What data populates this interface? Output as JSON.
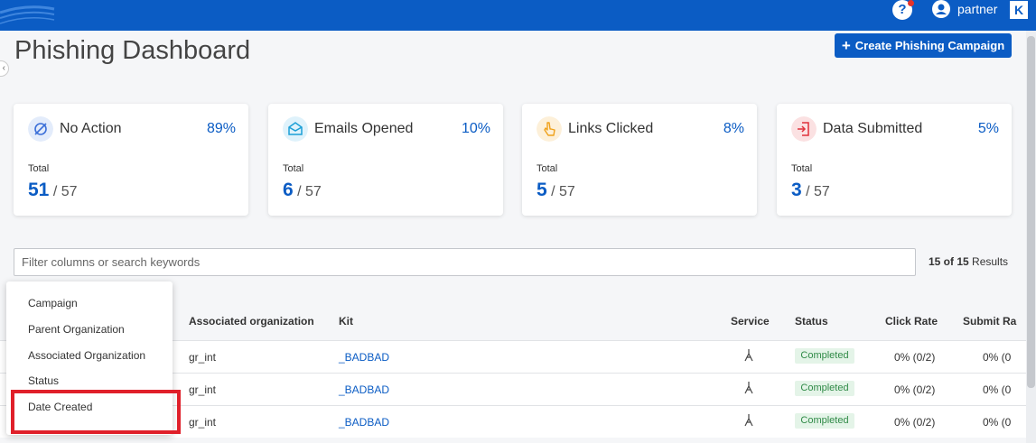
{
  "header": {
    "username": "partner",
    "help_icon": "?",
    "brand_mark": "K"
  },
  "page": {
    "title": "Phishing Dashboard",
    "create_button": "Create Phishing Campaign"
  },
  "stats": [
    {
      "name": "No Action",
      "percent": "89%",
      "total_label": "Total",
      "count": "51",
      "of_total": "/ 57",
      "icon": "no-action-icon",
      "color": "#3b6fd8"
    },
    {
      "name": "Emails Opened",
      "percent": "10%",
      "total_label": "Total",
      "count": "6",
      "of_total": "/ 57",
      "icon": "envelope-icon",
      "color": "#1b9fd6"
    },
    {
      "name": "Links Clicked",
      "percent": "8%",
      "total_label": "Total",
      "count": "5",
      "of_total": "/ 57",
      "icon": "pointer-hand-icon",
      "color": "#f0a11a"
    },
    {
      "name": "Data Submitted",
      "percent": "5%",
      "total_label": "Total",
      "count": "3",
      "of_total": "/ 57",
      "icon": "data-submit-icon",
      "color": "#e0303a"
    }
  ],
  "filter": {
    "placeholder": "Filter columns or search keywords",
    "results_count": "15 of 15",
    "results_label": "Results"
  },
  "table": {
    "columns": [
      "Associated organization",
      "Kit",
      "Service",
      "Status",
      "Click Rate",
      "Submit Ra"
    ],
    "rows": [
      {
        "org": "gr_int",
        "kit": "_BADBAD",
        "status": "Completed",
        "click_rate": "0% (0/2)",
        "submit_rate": "0% (0"
      },
      {
        "org": "gr_int",
        "kit": "_BADBAD",
        "status": "Completed",
        "click_rate": "0% (0/2)",
        "submit_rate": "0% (0"
      },
      {
        "org": "gr_int",
        "kit": "_BADBAD",
        "status": "Completed",
        "click_rate": "0% (0/2)",
        "submit_rate": "0% (0"
      }
    ]
  },
  "column_menu": {
    "items": [
      "Campaign",
      "Parent Organization",
      "Associated Organization",
      "Status",
      "Date Created"
    ],
    "highlighted": "Date Created",
    "highlight_color": "#e0202a"
  }
}
